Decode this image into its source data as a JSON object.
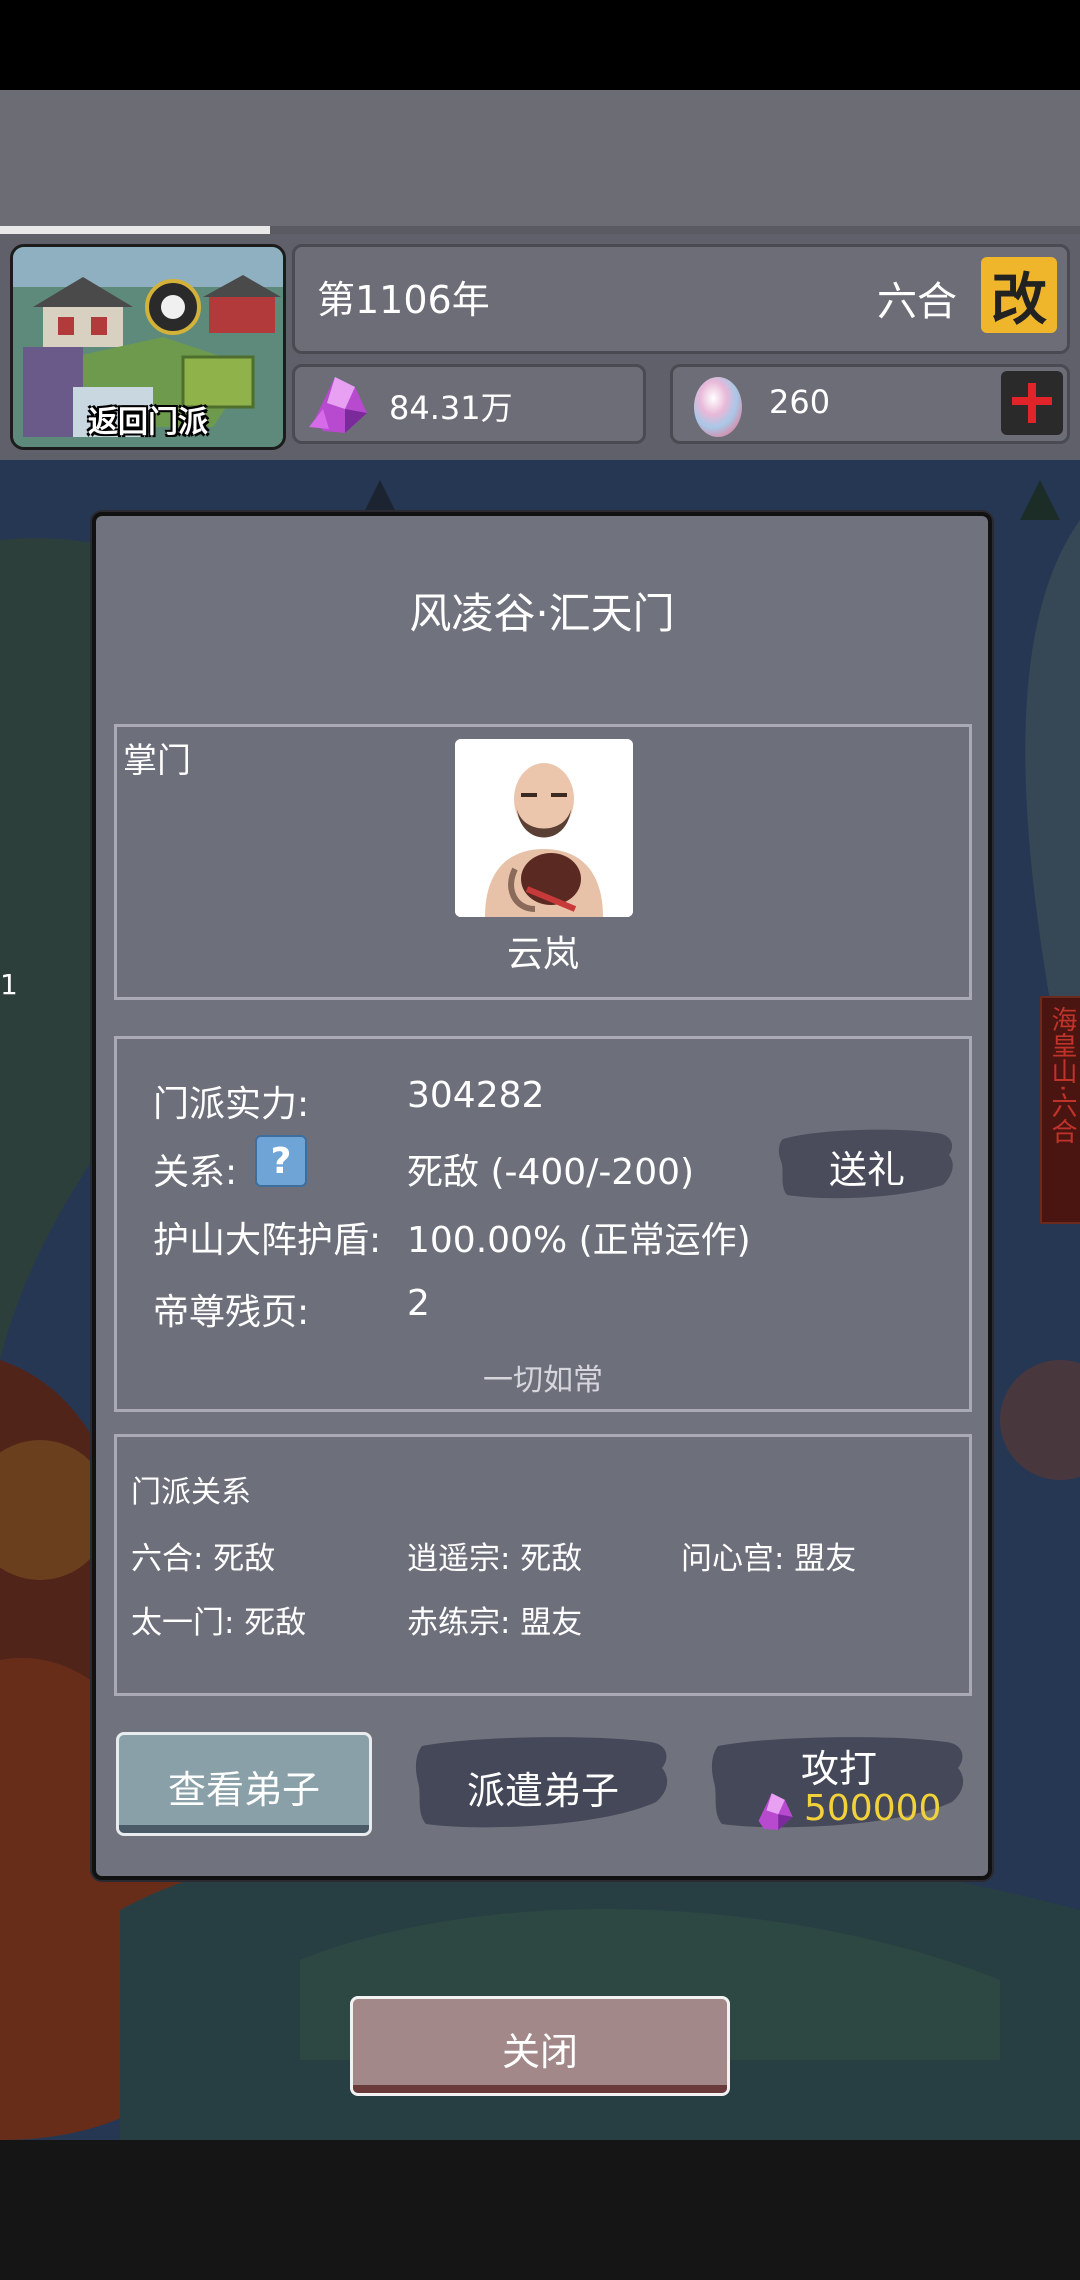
{
  "header": {
    "progress_fraction": 0.25,
    "thumbnail_label": "返回门派",
    "year_text": "第1106年",
    "sect_name": "六合",
    "rename_label": "改",
    "spirit_stones": "84.31万",
    "pills": "260"
  },
  "map": {
    "marker_text": "1",
    "side_banner": "海皇山·六合"
  },
  "dialog": {
    "title": "风凌谷·汇天门",
    "leader_label": "掌门",
    "leader_name": "云岚",
    "info": {
      "power_label": "门派实力:",
      "power_value": "304282",
      "relation_label": "关系:",
      "relation_help": "?",
      "relation_value": "死敌  (-400/-200)",
      "shield_label": "护山大阵护盾:",
      "shield_value": "100.00% (正常运作)",
      "pages_label": "帝尊残页:",
      "pages_value": "2",
      "gift_button": "送礼",
      "status_note": "一切如常"
    },
    "relations": {
      "title": "门派关系",
      "items": [
        "六合: 死敌",
        "逍遥宗: 死敌",
        "问心宫: 盟友",
        "太一门: 死敌",
        "赤练宗: 盟友"
      ]
    },
    "buttons": {
      "view_disciples": "查看弟子",
      "send_disciples": "派遣弟子",
      "attack": "攻打",
      "attack_cost": "500000"
    },
    "close": "关闭"
  },
  "colors": {
    "gold": "#f0b62b",
    "cost_yellow": "#f2d23a",
    "dialog_bg": "#70727e",
    "close_btn": "#a28889",
    "view_btn": "#8aa0a8"
  },
  "icons": [
    "spirit-crystal-icon",
    "pill-egg-icon",
    "plus-icon",
    "help-icon",
    "crystal-cost-icon"
  ]
}
